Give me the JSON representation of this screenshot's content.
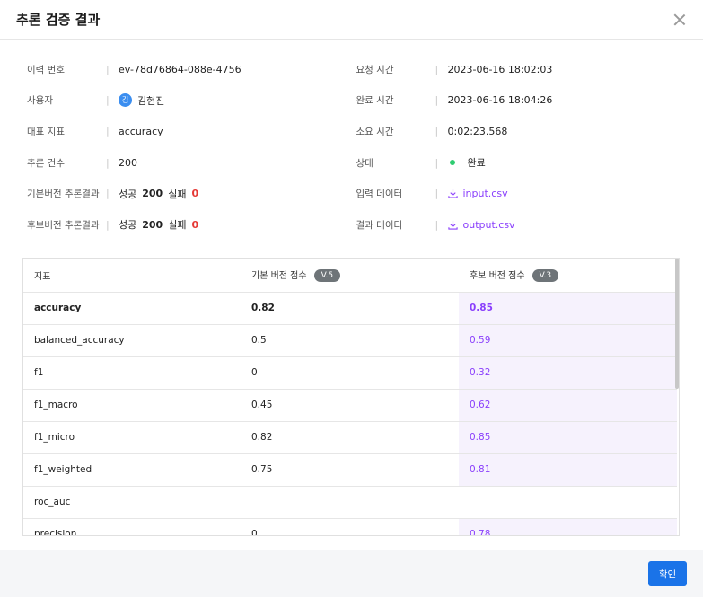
{
  "modal": {
    "title": "추론 검증 결과",
    "confirm_label": "확인"
  },
  "info_left": [
    {
      "label": "이력 번호",
      "value": "ev-78d76864-088e-4756"
    },
    {
      "label": "사용자",
      "avatar": "김",
      "value": "김현진"
    },
    {
      "label": "대표 지표",
      "value": "accuracy"
    },
    {
      "label": "추론 건수",
      "value": "200"
    },
    {
      "label": "기본버전 추론결과",
      "success_label": "성공",
      "success": "200",
      "fail_label": "실패",
      "fail": "0"
    },
    {
      "label": "후보버전 추론결과",
      "success_label": "성공",
      "success": "200",
      "fail_label": "실패",
      "fail": "0"
    }
  ],
  "info_right": [
    {
      "label": "요청 시간",
      "value": "2023-06-16 18:02:03"
    },
    {
      "label": "완료 시간",
      "value": "2023-06-16 18:04:26"
    },
    {
      "label": "소요 시간",
      "value": "0:02:23.568"
    },
    {
      "label": "상태",
      "value": "완료"
    },
    {
      "label": "입력 데이터",
      "value": "input.csv"
    },
    {
      "label": "결과 데이터",
      "value": "output.csv"
    }
  ],
  "table": {
    "headers": {
      "metric": "지표",
      "base": "기본 버전 점수",
      "base_badge": "V.5",
      "cand": "후보 버전 점수",
      "cand_badge": "V.3"
    },
    "rows": [
      {
        "metric": "accuracy",
        "base": "0.82",
        "cand": "0.85"
      },
      {
        "metric": "balanced_accuracy",
        "base": "0.5",
        "cand": "0.59"
      },
      {
        "metric": "f1",
        "base": "0",
        "cand": "0.32"
      },
      {
        "metric": "f1_macro",
        "base": "0.45",
        "cand": "0.62"
      },
      {
        "metric": "f1_micro",
        "base": "0.82",
        "cand": "0.85"
      },
      {
        "metric": "f1_weighted",
        "base": "0.75",
        "cand": "0.81"
      },
      {
        "metric": "roc_auc",
        "base": "",
        "cand": ""
      },
      {
        "metric": "precision",
        "base": "0",
        "cand": "0.78"
      }
    ]
  },
  "colors": {
    "accent": "#8a3ffc",
    "primary": "#1a73e8",
    "fail": "#e53935",
    "status_ok": "#2ecc71"
  }
}
